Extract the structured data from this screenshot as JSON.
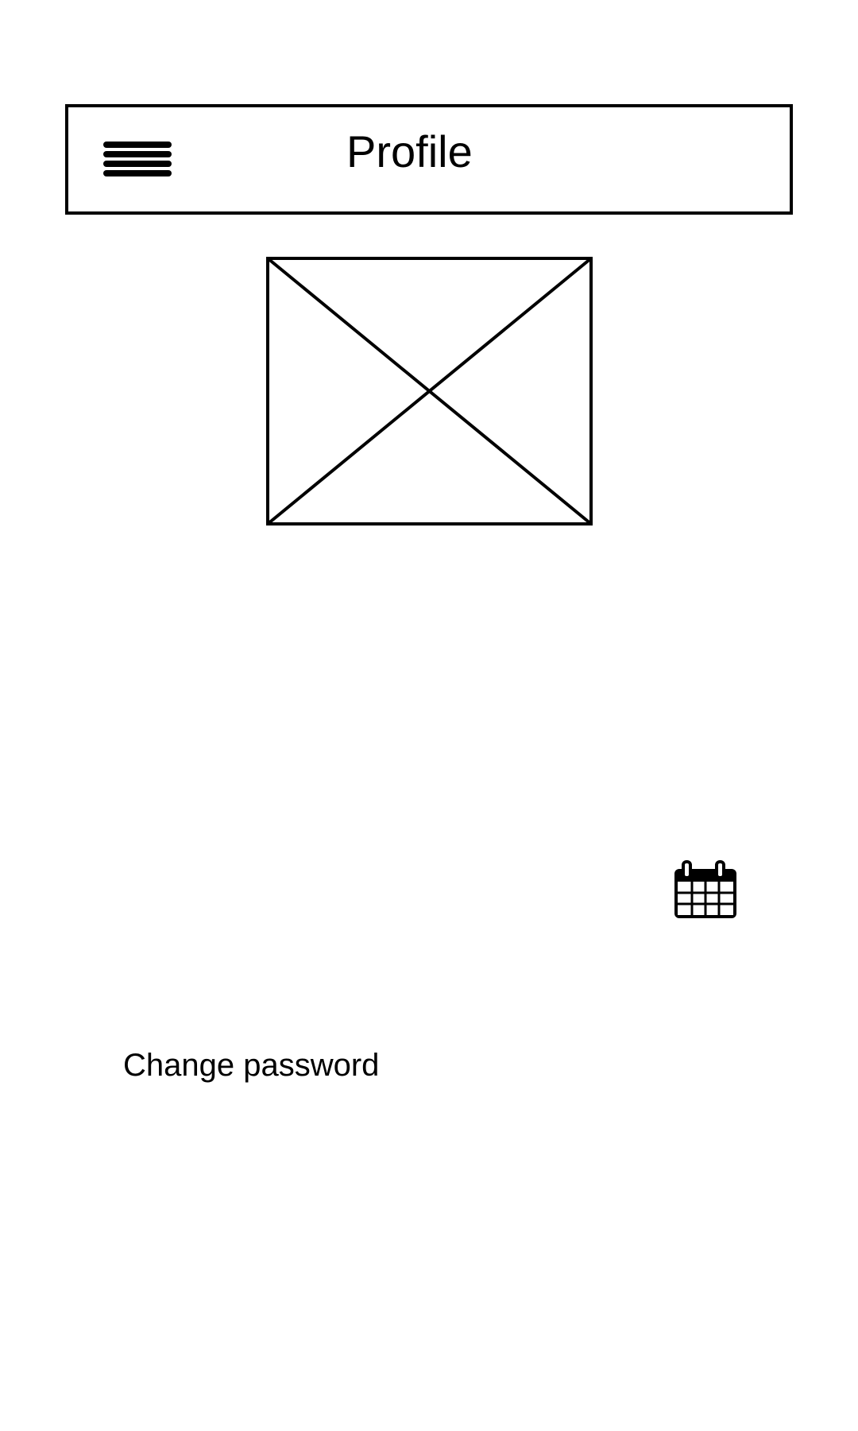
{
  "header": {
    "title": "Profile",
    "menu_icon": "hamburger-menu-icon"
  },
  "profile": {
    "image_placeholder": "image-placeholder"
  },
  "calendar": {
    "icon": "calendar-icon"
  },
  "actions": {
    "change_password_label": "Change password"
  },
  "colors": {
    "stroke": "#000000",
    "background": "#ffffff"
  }
}
